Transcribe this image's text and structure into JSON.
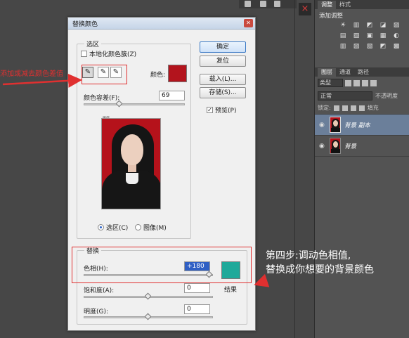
{
  "workspace": {
    "close_glyph": "×"
  },
  "right_panel": {
    "top_tabs": [
      "调整",
      "样式"
    ],
    "adjust_title": "添加调整",
    "adjust_icons_row1": [
      "☀",
      "▥",
      "◩",
      "◪",
      "▨"
    ],
    "adjust_icons_row2": [
      "▤",
      "▧",
      "▣",
      "▦",
      "◐"
    ],
    "adjust_icons_row3": [
      "▥",
      "▨",
      "▧",
      "◩",
      "▩"
    ],
    "layers_tabs": [
      "图层",
      "通道",
      "路径"
    ],
    "kind_label": "类型",
    "blend_mode": "正常",
    "opacity_label": "不透明度",
    "lock_label": "锁定:",
    "fill_label": "填充",
    "layers": [
      {
        "name": "背景 副本",
        "selected": true
      },
      {
        "name": "背景",
        "selected": false
      }
    ]
  },
  "dialog": {
    "title": "替换颜色",
    "close_glyph": "✕",
    "selection": {
      "legend": "选区",
      "localized_clusters": "本地化颜色簇(Z)",
      "color_label": "颜色:",
      "color_hex": "#b3141d",
      "fuzziness_label": "颜色容差(F):",
      "fuzziness_value": "69",
      "fuzziness_level": 0.34,
      "radio_selection": "选区(C)",
      "radio_image": "图像(M)"
    },
    "buttons": {
      "ok": "确定",
      "reset": "复位",
      "load": "载入(L)...",
      "save": "存储(S)..."
    },
    "preview": {
      "label": "预览(P)",
      "checked": true
    },
    "replacement": {
      "legend": "替换",
      "hue_label": "色相(H):",
      "hue_value": "+180",
      "hue_level": 1.0,
      "saturation_label": "饱和度(A):",
      "saturation_value": "0",
      "saturation_level": 0.5,
      "lightness_label": "明度(G):",
      "lightness_value": "0",
      "lightness_level": 0.5,
      "result_label": "结果",
      "result_hex": "#1fa99a"
    }
  },
  "annotations": {
    "left_text": "添加或减去颜色差值",
    "right_line1": "第四步:调动色相值,",
    "right_line2": "替换成你想要的背景颜色",
    "color": "#e03030"
  }
}
